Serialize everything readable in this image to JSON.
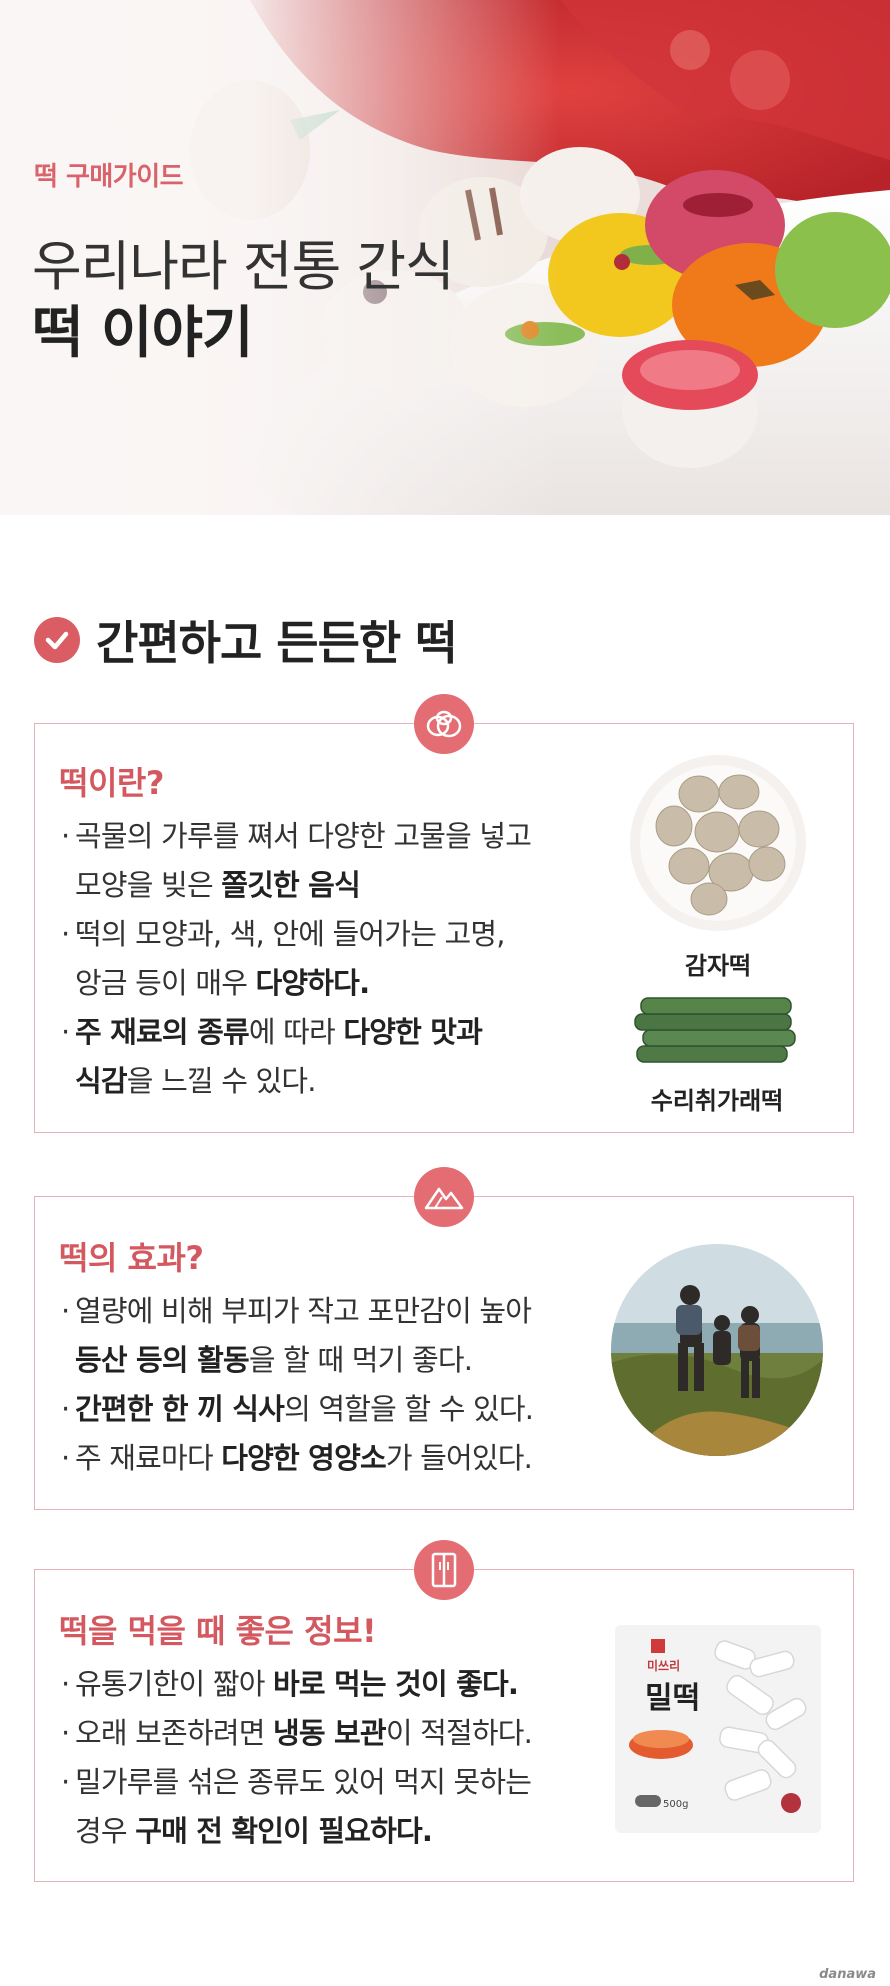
{
  "hero": {
    "kicker": "떡 구매가이드",
    "title_line1": "우리나라 전통 간식",
    "title_line2": "떡 이야기"
  },
  "section": {
    "title": "간편하고 든든한 떡"
  },
  "cards": [
    {
      "icon": "rice-cake-icon",
      "title": "떡이란?",
      "lines": [
        {
          "dot": "·",
          "segments": [
            "곡물의 가루를 쪄서 다양한 고물을 넣고"
          ]
        },
        {
          "dot": "",
          "segments": [
            "모양을 빚은 ",
            "쫄깃한 음식"
          ]
        },
        {
          "dot": "·",
          "segments": [
            "떡의 모양과, 색, 안에 들어가는 고명,"
          ]
        },
        {
          "dot": "",
          "segments": [
            "앙금 등이 매우 ",
            "다양하다."
          ]
        },
        {
          "dot": "·",
          "segments": [
            "주 재료의 종류",
            "에 따라 ",
            "다양한 맛과"
          ]
        },
        {
          "dot": "",
          "segments": [
            "식감",
            "을 느낄 수 있다."
          ]
        }
      ],
      "captions": [
        "감자떡",
        "수리취가래떡"
      ]
    },
    {
      "icon": "mountain-icon",
      "title": "떡의 효과?",
      "lines": [
        {
          "dot": "·",
          "segments": [
            "열량에 비해 부피가 작고 포만감이 높아"
          ]
        },
        {
          "dot": "",
          "segments": [
            "등산 등의 활동",
            "을 할 때 먹기 좋다."
          ]
        },
        {
          "dot": "·",
          "segments": [
            "간편한 한 끼 식사",
            "의 역할을 할 수 있다."
          ]
        },
        {
          "dot": "·",
          "segments": [
            "주 재료마다 ",
            "다양한 영양소",
            "가 들어있다."
          ]
        }
      ]
    },
    {
      "icon": "refrigerator-icon",
      "title": "떡을 먹을 때 좋은 정보!",
      "lines": [
        {
          "dot": "·",
          "segments": [
            "유통기한이 짧아 ",
            "바로 먹는 것이 좋다."
          ]
        },
        {
          "dot": "·",
          "segments": [
            "오래 보존하려면 ",
            "냉동 보관",
            "이 적절하다."
          ]
        },
        {
          "dot": "·",
          "segments": [
            "밀가루를 섞은 종류도 있어 먹지 못하는"
          ]
        },
        {
          "dot": "",
          "segments": [
            "경우 ",
            "구매 전 확인이 필요하다."
          ]
        }
      ],
      "package": {
        "brand": "미쓰리",
        "name": "밀떡",
        "weight": "500g"
      }
    }
  ],
  "watermark": "danawa",
  "colors": {
    "accent": "#d95d63",
    "border": "#e3b5b8",
    "badge": "#e46d74"
  }
}
